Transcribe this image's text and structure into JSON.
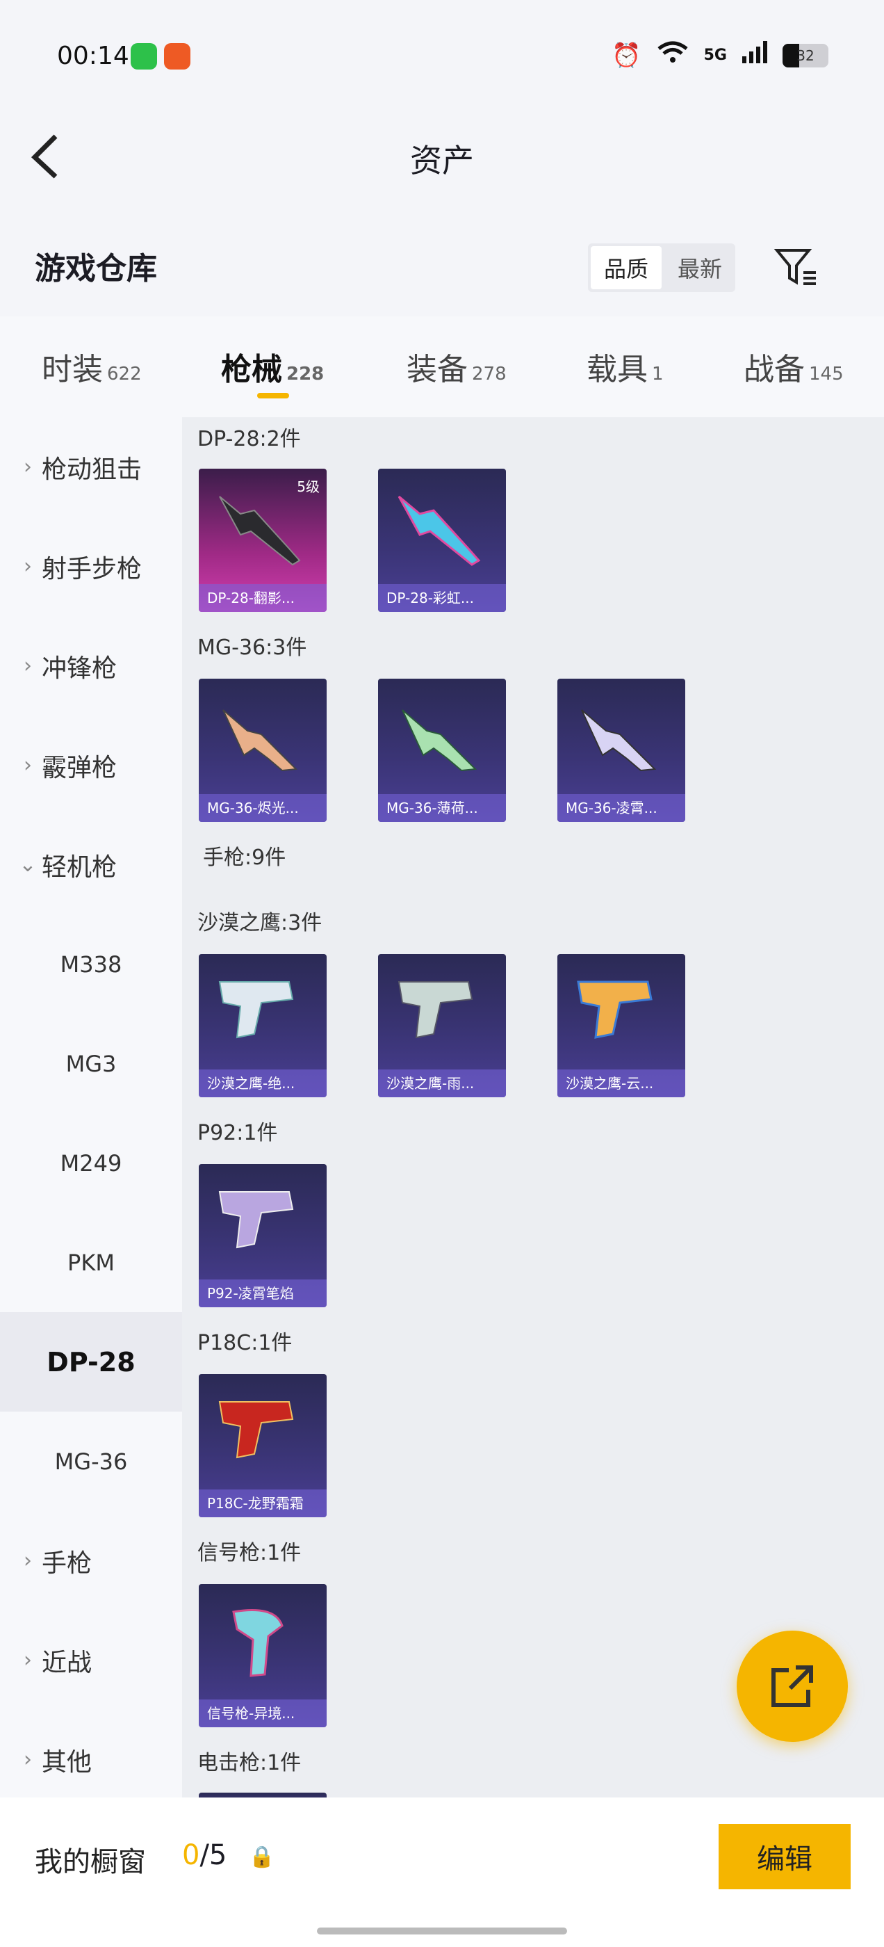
{
  "status_bar": {
    "time": "00:14",
    "network": "5G",
    "battery": "32"
  },
  "header": {
    "title": "资产"
  },
  "warehouse": {
    "title": "游戏仓库",
    "sort_quality": "品质",
    "sort_newest": "最新"
  },
  "tabs": [
    {
      "label": "时装",
      "count": "622"
    },
    {
      "label": "枪械",
      "count": "228"
    },
    {
      "label": "装备",
      "count": "278"
    },
    {
      "label": "载具",
      "count": "1"
    },
    {
      "label": "战备",
      "count": "145"
    }
  ],
  "sidebar": {
    "items": [
      {
        "label": "枪动狙击"
      },
      {
        "label": "射手步枪"
      },
      {
        "label": "冲锋枪"
      },
      {
        "label": "霰弹枪"
      },
      {
        "label": "轻机枪"
      },
      {
        "label": "M338"
      },
      {
        "label": "MG3"
      },
      {
        "label": "M249"
      },
      {
        "label": "PKM"
      },
      {
        "label": "DP-28"
      },
      {
        "label": "MG-36"
      },
      {
        "label": "手枪"
      },
      {
        "label": "近战"
      },
      {
        "label": "其他"
      }
    ]
  },
  "groups": [
    {
      "label": "DP-28:2件",
      "items": [
        {
          "name": "DP-28-翻影...",
          "level": "5级"
        },
        {
          "name": "DP-28-彩虹..."
        }
      ]
    },
    {
      "label": "MG-36:3件",
      "items": [
        {
          "name": "MG-36-烬光..."
        },
        {
          "name": "MG-36-薄荷..."
        },
        {
          "name": "MG-36-凌霄..."
        }
      ]
    },
    {
      "label": "手枪:9件"
    },
    {
      "label": "沙漠之鹰:3件",
      "items": [
        {
          "name": "沙漠之鹰-绝..."
        },
        {
          "name": "沙漠之鹰-雨..."
        },
        {
          "name": "沙漠之鹰-云..."
        }
      ]
    },
    {
      "label": "P92:1件",
      "items": [
        {
          "name": "P92-凌霄笔焰"
        }
      ]
    },
    {
      "label": "P18C:1件",
      "items": [
        {
          "name": "P18C-龙野霜霜"
        }
      ]
    },
    {
      "label": "信号枪:1件",
      "items": [
        {
          "name": "信号枪-异境..."
        }
      ]
    },
    {
      "label": "电击枪:1件"
    }
  ],
  "bottom": {
    "showcase_label": "我的橱窗",
    "showcase_current": "0",
    "showcase_total": "/5",
    "edit_label": "编辑"
  },
  "colors": {
    "accent": "#f5b500",
    "card_purple": "#3a3475",
    "card_pink": "#d23fb0"
  }
}
